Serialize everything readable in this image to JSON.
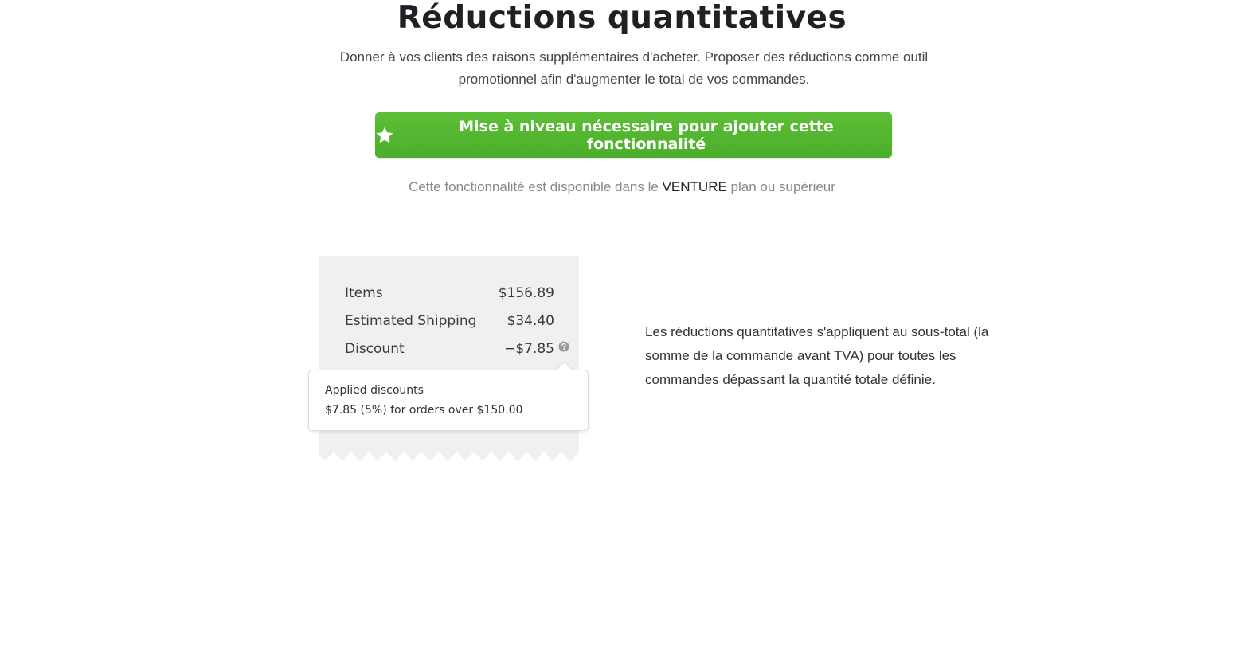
{
  "header": {
    "title": "Réductions quantitatives",
    "subtitle": "Donner à vos clients des raisons supplémentaires d'acheter. Proposer des réductions comme outil promotionnel afin d'augmenter le total de vos commandes."
  },
  "upgrade": {
    "label": "Mise à niveau nécessaire pour ajouter cette fonctionnalité",
    "icon": "star-icon",
    "color": "#55b830"
  },
  "availability": {
    "prefix": "Cette fonctionnalité est disponible dans le",
    "plan": "VENTURE",
    "suffix": "plan ou supérieur"
  },
  "receipt": {
    "rows": [
      {
        "label": "Items",
        "value": "$156.89"
      },
      {
        "label": "Estimated Shipping",
        "value": "$34.40"
      },
      {
        "label": "Discount",
        "value": "−$7.85"
      }
    ],
    "help_icon": "question-circle-icon",
    "tooltip": {
      "title": "Applied discounts",
      "detail": "$7.85 (5%) for orders over $150.00"
    }
  },
  "description": "Les réductions quantitatives s'appliquent au sous-total (la somme de la commande avant TVA) pour toutes les commandes dépassant la quantité totale définie."
}
